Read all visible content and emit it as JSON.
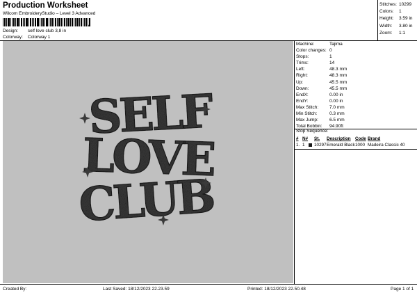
{
  "header": {
    "title": "Production Worksheet",
    "subtitle": "Wilcom EmbroideryStudio – Level 3 Advanced",
    "barcode_tail": ","
  },
  "design_info": {
    "design_label": "Design:",
    "design_value": "self love club 3,8 in",
    "colorway_label": "Colorway:",
    "colorway_value": "Colorway 1"
  },
  "stats": [
    {
      "label": "Stitches:",
      "value": "10299"
    },
    {
      "label": "Colors:",
      "value": "1"
    },
    {
      "label": "Height:",
      "value": "3.59 in"
    },
    {
      "label": "Width:",
      "value": "3.80 in"
    },
    {
      "label": "Zoom:",
      "value": "1:1"
    }
  ],
  "artwork": {
    "lines": [
      "SELF",
      "LOVE",
      "CLUB"
    ],
    "thread_color": "#3a3a3a",
    "background_color": "#c0c0c0"
  },
  "machine_info": [
    {
      "label": "Machine:",
      "value": "Tajima"
    },
    {
      "label": "Color changes:",
      "value": "0"
    },
    {
      "label": "Stops:",
      "value": "1"
    },
    {
      "label": "Trims:",
      "value": "14"
    },
    {
      "label": "Left:",
      "value": "48.3 mm"
    },
    {
      "label": "Right:",
      "value": "48.3 mm"
    },
    {
      "label": "Up:",
      "value": "45.5 mm"
    },
    {
      "label": "Down:",
      "value": "45.5 mm"
    },
    {
      "label": "EndX:",
      "value": "0.00 in"
    },
    {
      "label": "EndY:",
      "value": "0.00 in"
    },
    {
      "label": "Max Stitch:",
      "value": "7.0 mm"
    },
    {
      "label": "Min Stitch:",
      "value": "0.3 mm"
    },
    {
      "label": "Max Jump:",
      "value": "6.5 mm"
    },
    {
      "label": "Total Bobbin:",
      "value": "94.90ft"
    }
  ],
  "stop_sequence": {
    "title": "Stop Sequence:",
    "headers": [
      "#",
      "N#",
      "",
      "St.",
      "Description",
      "Code",
      "Brand"
    ],
    "rows": [
      {
        "num": "1.",
        "needle": "1",
        "swatch_color": "#1a1a1a",
        "stitches": "10297",
        "description": "Emerald Black",
        "code": "1000",
        "brand": "Madeira Classic 40"
      }
    ]
  },
  "footer": {
    "created_by": "Created By:",
    "last_saved": "Last Saved: 18/12/2023 22.23.59",
    "printed": "Printed: 18/12/2023 22.50.48",
    "page": "Page 1 of 1"
  }
}
